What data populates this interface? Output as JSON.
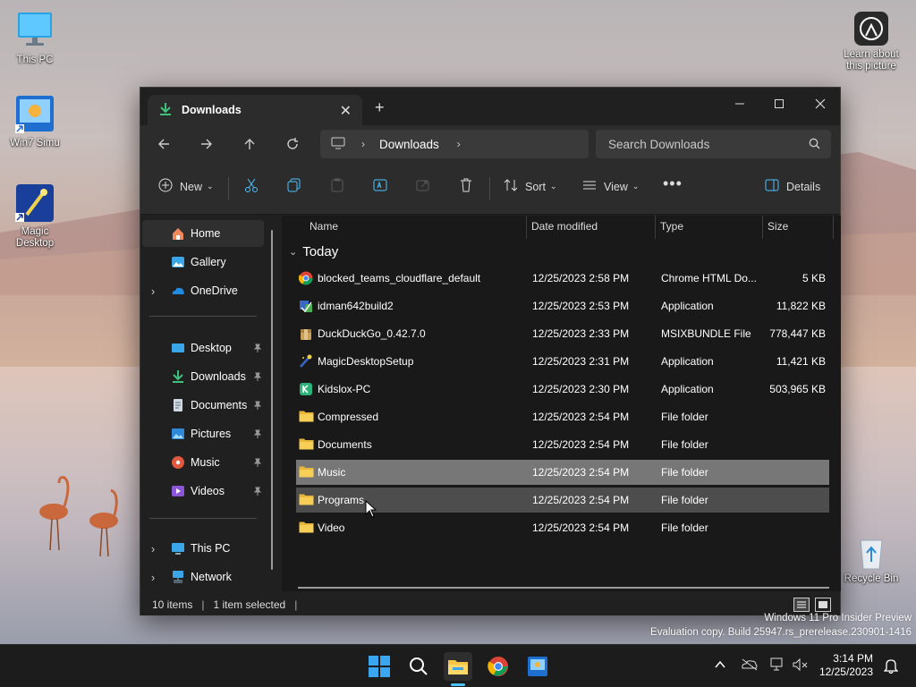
{
  "desktop": {
    "icons": [
      {
        "label": "This PC"
      },
      {
        "label": "Win7 Simu"
      },
      {
        "label": "Magic Desktop"
      },
      {
        "label": "Learn about this picture"
      },
      {
        "label": "Recycle Bin"
      }
    ],
    "watermark": {
      "line1": "Windows 11 Pro Insider Preview",
      "line2": "Evaluation copy. Build 25947.rs_prerelease.230901-1416"
    }
  },
  "explorer": {
    "tab": {
      "title": "Downloads"
    },
    "address": {
      "segment": "Downloads"
    },
    "search": {
      "placeholder": "Search Downloads"
    },
    "commands": {
      "new_label": "New",
      "sort_label": "Sort",
      "view_label": "View",
      "details_label": "Details"
    },
    "sidebar": {
      "top": [
        {
          "label": "Home"
        },
        {
          "label": "Gallery"
        },
        {
          "label": "OneDrive"
        }
      ],
      "pinned": [
        {
          "label": "Desktop"
        },
        {
          "label": "Downloads"
        },
        {
          "label": "Documents"
        },
        {
          "label": "Pictures"
        },
        {
          "label": "Music"
        },
        {
          "label": "Videos"
        }
      ],
      "bottom": [
        {
          "label": "This PC"
        },
        {
          "label": "Network"
        }
      ]
    },
    "columns": {
      "name": "Name",
      "date": "Date modified",
      "type": "Type",
      "size": "Size"
    },
    "group": "Today",
    "files": [
      {
        "name": "blocked_teams_cloudflare_default",
        "date": "12/25/2023 2:58 PM",
        "type": "Chrome HTML Do...",
        "size": "5 KB",
        "icon": "chrome-icon"
      },
      {
        "name": "idman642build2",
        "date": "12/25/2023 2:53 PM",
        "type": "Application",
        "size": "11,822 KB",
        "icon": "installer-icon"
      },
      {
        "name": "DuckDuckGo_0.42.7.0",
        "date": "12/25/2023 2:33 PM",
        "type": "MSIXBUNDLE File",
        "size": "778,447 KB",
        "icon": "package-icon"
      },
      {
        "name": "MagicDesktopSetup",
        "date": "12/25/2023 2:31 PM",
        "type": "Application",
        "size": "11,421 KB",
        "icon": "wand-icon"
      },
      {
        "name": "Kidslox-PC",
        "date": "12/25/2023 2:30 PM",
        "type": "Application",
        "size": "503,965 KB",
        "icon": "kidslox-icon"
      },
      {
        "name": "Compressed",
        "date": "12/25/2023 2:54 PM",
        "type": "File folder",
        "size": "",
        "icon": "folder-icon"
      },
      {
        "name": "Documents",
        "date": "12/25/2023 2:54 PM",
        "type": "File folder",
        "size": "",
        "icon": "folder-icon"
      },
      {
        "name": "Music",
        "date": "12/25/2023 2:54 PM",
        "type": "File folder",
        "size": "",
        "icon": "folder-icon"
      },
      {
        "name": "Programs",
        "date": "12/25/2023 2:54 PM",
        "type": "File folder",
        "size": "",
        "icon": "folder-icon"
      },
      {
        "name": "Video",
        "date": "12/25/2023 2:54 PM",
        "type": "File folder",
        "size": "",
        "icon": "folder-icon"
      }
    ],
    "status": {
      "items": "10 items",
      "selected": "1 item selected"
    }
  },
  "taskbar": {
    "time": "3:14 PM",
    "date": "12/25/2023"
  },
  "colors": {
    "window_bg": "#202020",
    "selection": "#777777",
    "folder": "#f4c542",
    "accent": "#4cc2ff"
  }
}
